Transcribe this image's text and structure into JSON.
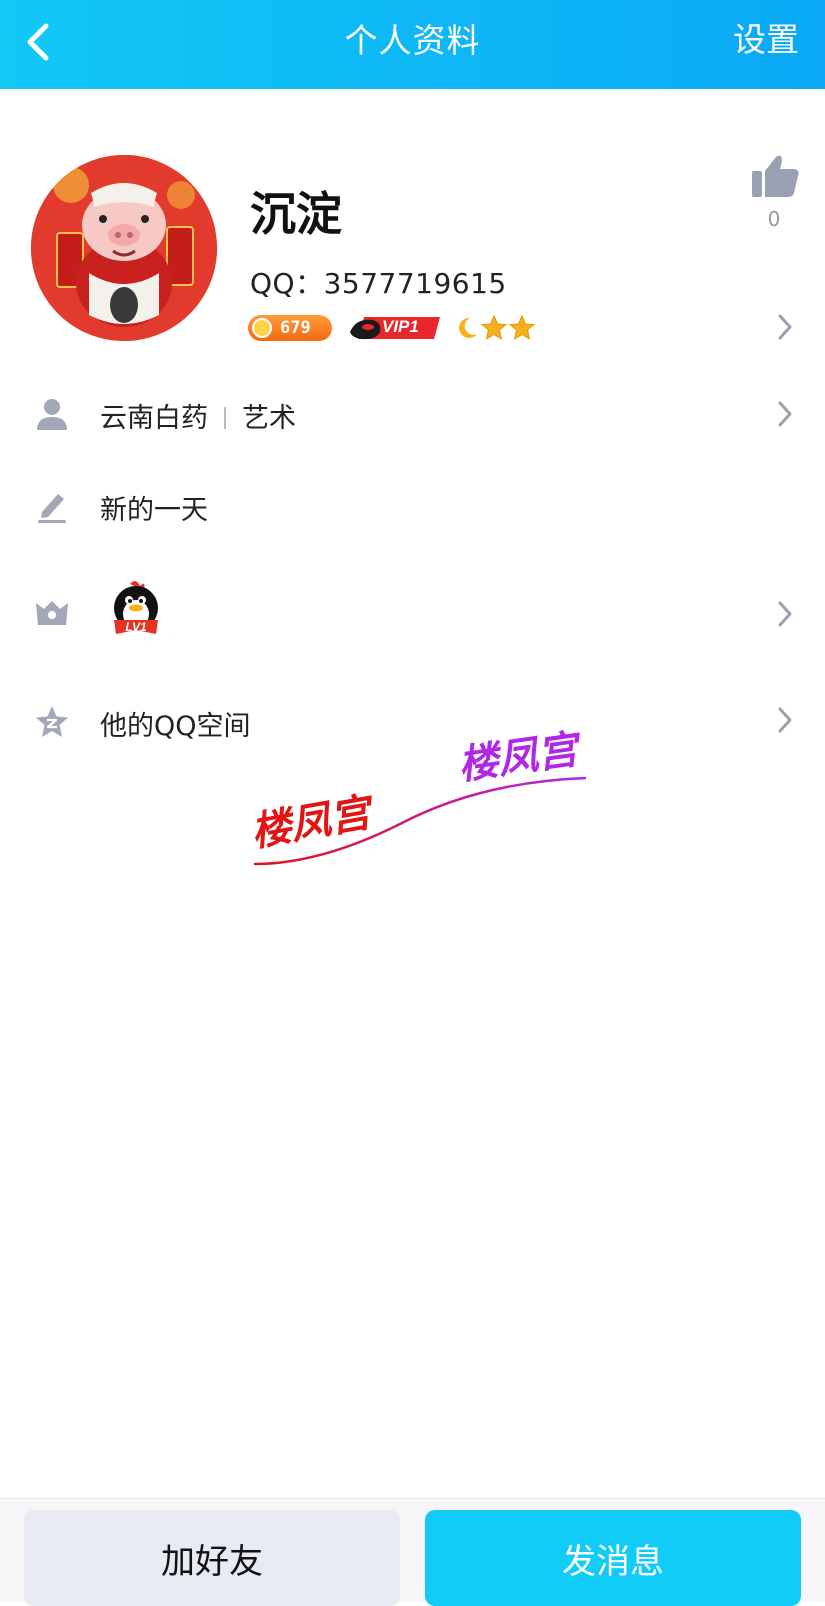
{
  "header": {
    "title": "个人资料",
    "back_icon": "chevron-left-icon",
    "settings_label": "设置"
  },
  "profile": {
    "nickname": "沉淀",
    "qq_label": "QQ：3577719615",
    "coin_value": "679",
    "vip_label": "VIP1",
    "level_icons": [
      "moon-icon",
      "star-icon",
      "star-icon"
    ],
    "like_count": "0"
  },
  "rows": {
    "info": {
      "icon": "person-icon",
      "company": "云南白药",
      "occupation": "艺术"
    },
    "signature": {
      "icon": "pencil-icon",
      "text": "新的一天"
    },
    "badge": {
      "icon": "crown-icon",
      "badge_text": "LV1"
    },
    "qzone": {
      "icon": "qzone-star-icon",
      "text": "他的QQ空间"
    }
  },
  "watermark": {
    "text_left": "楼凤宫",
    "text_right": "楼凤宫"
  },
  "footer": {
    "add_friend": "加好友",
    "send_message": "发消息"
  },
  "colors": {
    "header": "#12c8f5",
    "primary_button": "#12ccf8",
    "secondary_button": "#e7eaf3"
  }
}
